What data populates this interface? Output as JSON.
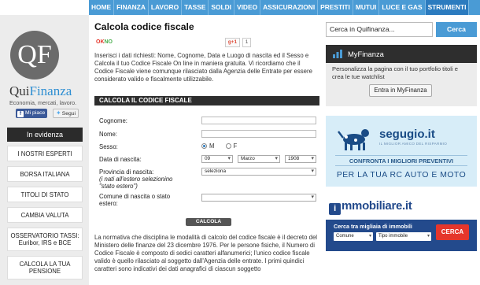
{
  "nav": {
    "items": [
      {
        "label": "HOME"
      },
      {
        "label": "FINANZA"
      },
      {
        "label": "LAVORO"
      },
      {
        "label": "TASSE"
      },
      {
        "label": "SOLDI"
      },
      {
        "label": "VIDEO"
      },
      {
        "label": "ASSICURAZIONI"
      },
      {
        "label": "PRESTITI"
      },
      {
        "label": "MUTUI"
      },
      {
        "label": "LUCE E GAS"
      },
      {
        "label": "STRUMENTI"
      }
    ],
    "active_color": "#2b7bbf",
    "bar_color": "#4a9bd5"
  },
  "sidebar": {
    "logo_text": "QF",
    "brand_qui": "Qui",
    "brand_finanza": "Finanza",
    "tagline": "Economia, mercati, lavoro.",
    "fb_label": "Mi piace",
    "tw_label": "Segui",
    "evidenza_title": "In evidenza",
    "evidenza_items": [
      {
        "label": "I NOSTRI ESPERTI"
      },
      {
        "label": "BORSA ITALIANA"
      },
      {
        "label": "TITOLI DI STATO"
      },
      {
        "label": "CAMBIA VALUTA"
      },
      {
        "label": "OSSERVATORIO TASSI: Euribor, IRS e BCE"
      },
      {
        "label": "CALCOLA LA TUA PENSIONE"
      }
    ]
  },
  "main": {
    "title": "Calcola codice fiscale",
    "okno_ok": "OK",
    "okno_no": "NO",
    "gplus_label": "g+1",
    "gplus_count": "1",
    "intro": "Inserisci i dati richiesti: Nome, Cognome, Data e Luogo di nascita ed il Sesso e Calcola il tuo Codice Fiscale On line in maniera gratuita. Vi ricordiamo che il Codice Fiscale viene comunque rilasciato dalla Agenzia delle Entrate per essere considerato valido e fiscalmente utilizzabile.",
    "section_title": "CALCOLA IL CODICE FISCALE",
    "form": {
      "cognome_label": "Cognome:",
      "nome_label": "Nome:",
      "sesso_label": "Sesso:",
      "sesso_m": "M",
      "sesso_f": "F",
      "data_label": "Data di nascita:",
      "giorno": "09",
      "mese": "Marzo",
      "anno": "1908",
      "provincia_label": "Provincia di nascita:",
      "provincia_note_1": "(i nati all'estero selezionino",
      "provincia_note_2": "\"stato estero\")",
      "provincia_value": "seleziona",
      "comune_label_1": "Comune di nascita o stato",
      "comune_label_2": "estero:",
      "calcola_label": "CALCOLA"
    },
    "normativa": "La normativa che disciplina le modalità di calcolo del codice fiscale è il decreto del Ministero delle finanze del 23 dicembre 1976. Per le persone fisiche, il Numero di Codice Fiscale è composto di sedici caratteri alfanumerici; l'unico codice fiscale valido è quello rilasciato al soggetto dall'Agenzia delle entrate. I primi quindici caratteri sono indicativi dei dati anagrafici di ciascun soggetto"
  },
  "right": {
    "search_placeholder": "Cerca in Quifinanza...",
    "search_button": "Cerca",
    "myfinanza_title": "MyFinanza",
    "myfinanza_text": "Personalizza la pagina con il tuo portfolio titoli e crea le tue watchlist",
    "myfinanza_button": "Entra in MyFinanza",
    "segugio_logo": "segugio.it",
    "segugio_sub": "IL MIGLIOR AMICO DEL RISPARMIO",
    "segugio_conf": "CONFRONTA I MIGLIORI PREVENTIVI",
    "segugio_rc": "PER LA TUA RC AUTO E MOTO",
    "immo_logo_i": "i",
    "immo_logo": "mmobiliare.it",
    "immo_title": "Cerca tra migliaia di immobili",
    "immo_comune": "Comune",
    "immo_tipo": "Tipo immobile",
    "immo_button": "CERCA"
  }
}
